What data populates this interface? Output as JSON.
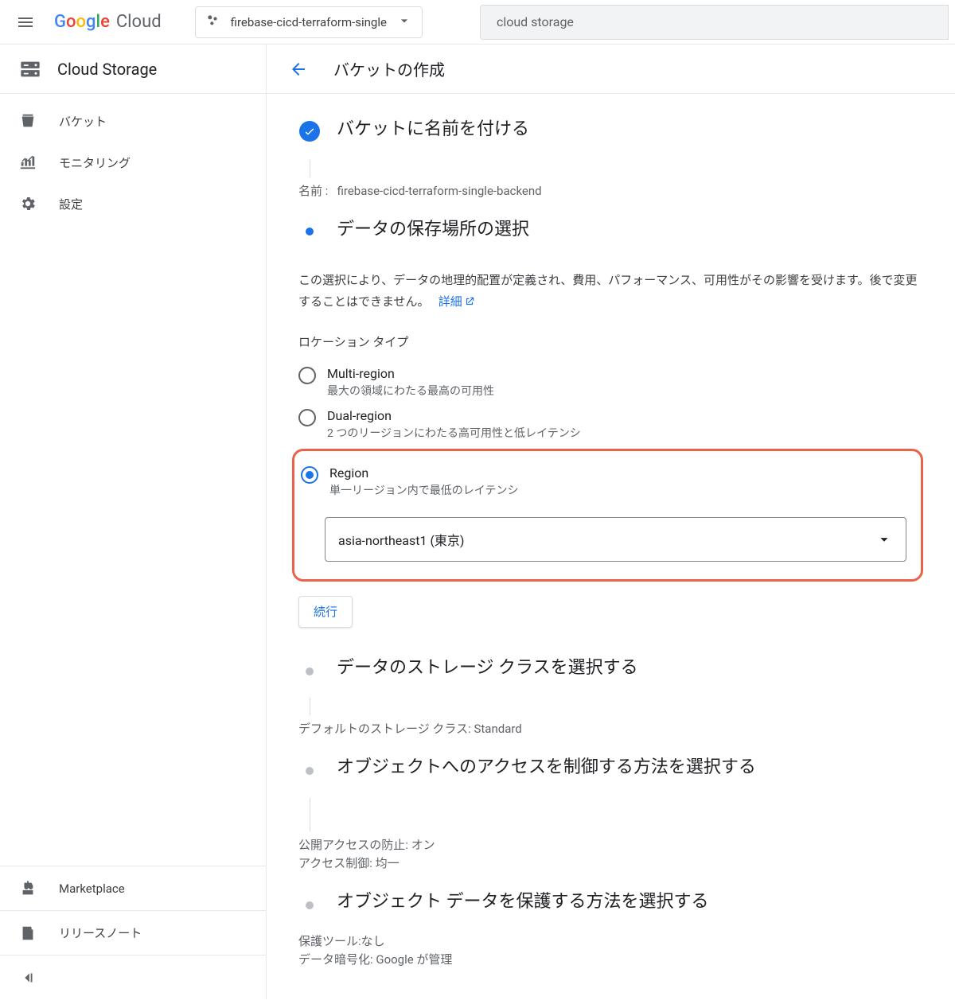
{
  "header": {
    "logo_text": "Google",
    "logo_suffix": "Cloud",
    "project_name": "firebase-cicd-terraform-single",
    "search_text": "cloud storage"
  },
  "sidebar": {
    "title": "Cloud Storage",
    "items": [
      {
        "label": "バケット",
        "icon": "bucket"
      },
      {
        "label": "モニタリング",
        "icon": "monitoring"
      },
      {
        "label": "設定",
        "icon": "gear"
      }
    ],
    "bottom": [
      {
        "label": "Marketplace",
        "icon": "cart"
      },
      {
        "label": "リリースノート",
        "icon": "notes"
      }
    ]
  },
  "main": {
    "page_title": "バケットの作成",
    "step1": {
      "title": "バケットに名前を付ける",
      "name_label": "名前 :",
      "name_value": "firebase-cicd-terraform-single-backend"
    },
    "step2": {
      "title": "データの保存場所の選択",
      "desc_prefix": "この選択により、データの地理的配置が定義され、費用、パフォーマンス、可用性がその影響を受けます。後で変更することはできません。",
      "details_link": "詳細",
      "location_type_label": "ロケーション タイプ",
      "options": {
        "multi": {
          "label": "Multi-region",
          "sub": "最大の領域にわたる最高の可用性"
        },
        "dual": {
          "label": "Dual-region",
          "sub": "2 つのリージョンにわたる高可用性と低レイテンシ"
        },
        "region": {
          "label": "Region",
          "sub": "単一リージョン内で最低のレイテンシ"
        }
      },
      "region_value": "asia-northeast1 (東京)",
      "continue": "続行"
    },
    "step3": {
      "title": "データのストレージ クラスを選択する",
      "summary": "デフォルトのストレージ クラス: Standard"
    },
    "step4": {
      "title": "オブジェクトへのアクセスを制御する方法を選択する",
      "line1": "公開アクセスの防止: オン",
      "line2": "アクセス制御: 均一"
    },
    "step5": {
      "title": "オブジェクト データを保護する方法を選択する",
      "line1": "保護ツール:なし",
      "line2": "データ暗号化: Google が管理"
    }
  }
}
